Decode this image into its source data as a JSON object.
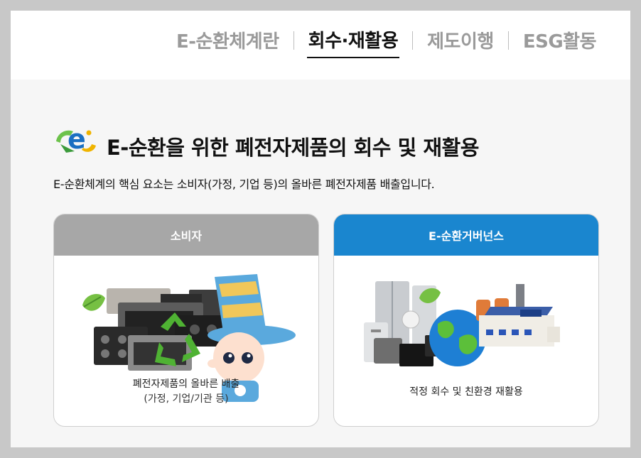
{
  "nav": {
    "tabs": [
      {
        "label": "E-순환체계란",
        "active": false
      },
      {
        "label": "회수·재활용",
        "active": true
      },
      {
        "label": "제도이행",
        "active": false
      },
      {
        "label": "ESG활동",
        "active": false
      }
    ]
  },
  "section": {
    "logo_icon": "e-recycle-logo-icon",
    "title": "E-순환을 위한 폐전자제품의 회수 및 재활용",
    "description": "E-순환체계의 핵심 요소는 소비자(가정, 기업 등)의 올바른 폐전자제품 배출입니다."
  },
  "cards": [
    {
      "header": "소비자",
      "header_color": "#a7a7a7",
      "illustration": "appliances-recycle-mascot",
      "caption_line1": "폐전자제품의 올바른 배출",
      "caption_line2": "(가정, 기업/기관 등)"
    },
    {
      "header": "E-순환거버넌스",
      "header_color": "#1a86cf",
      "illustration": "appliances-earth-factory",
      "caption_line1": "적정 회수 및 친환경 재활용"
    }
  ],
  "colors": {
    "active_tab": "#111111",
    "inactive_tab": "#9a9a9a",
    "accent_blue": "#1a86cf"
  }
}
